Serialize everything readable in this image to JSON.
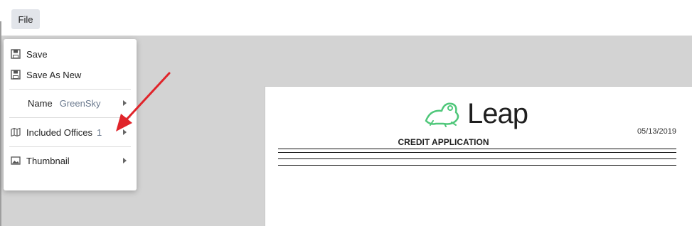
{
  "menubar": {
    "file_label": "File"
  },
  "file_menu": {
    "save_label": "Save",
    "save_as_new_label": "Save As New",
    "name_label": "Name",
    "name_value": "GreenSky",
    "included_offices_label": "Included Offices",
    "included_offices_count": "1",
    "thumbnail_label": "Thumbnail"
  },
  "document": {
    "logo_text": "Leap",
    "title": "CREDIT APPLICATION",
    "date": "05/13/2019"
  },
  "colors": {
    "accent_arrow": "#e0242a",
    "logo_green": "#4fc77a",
    "menu_value": "#6b7a8f"
  }
}
